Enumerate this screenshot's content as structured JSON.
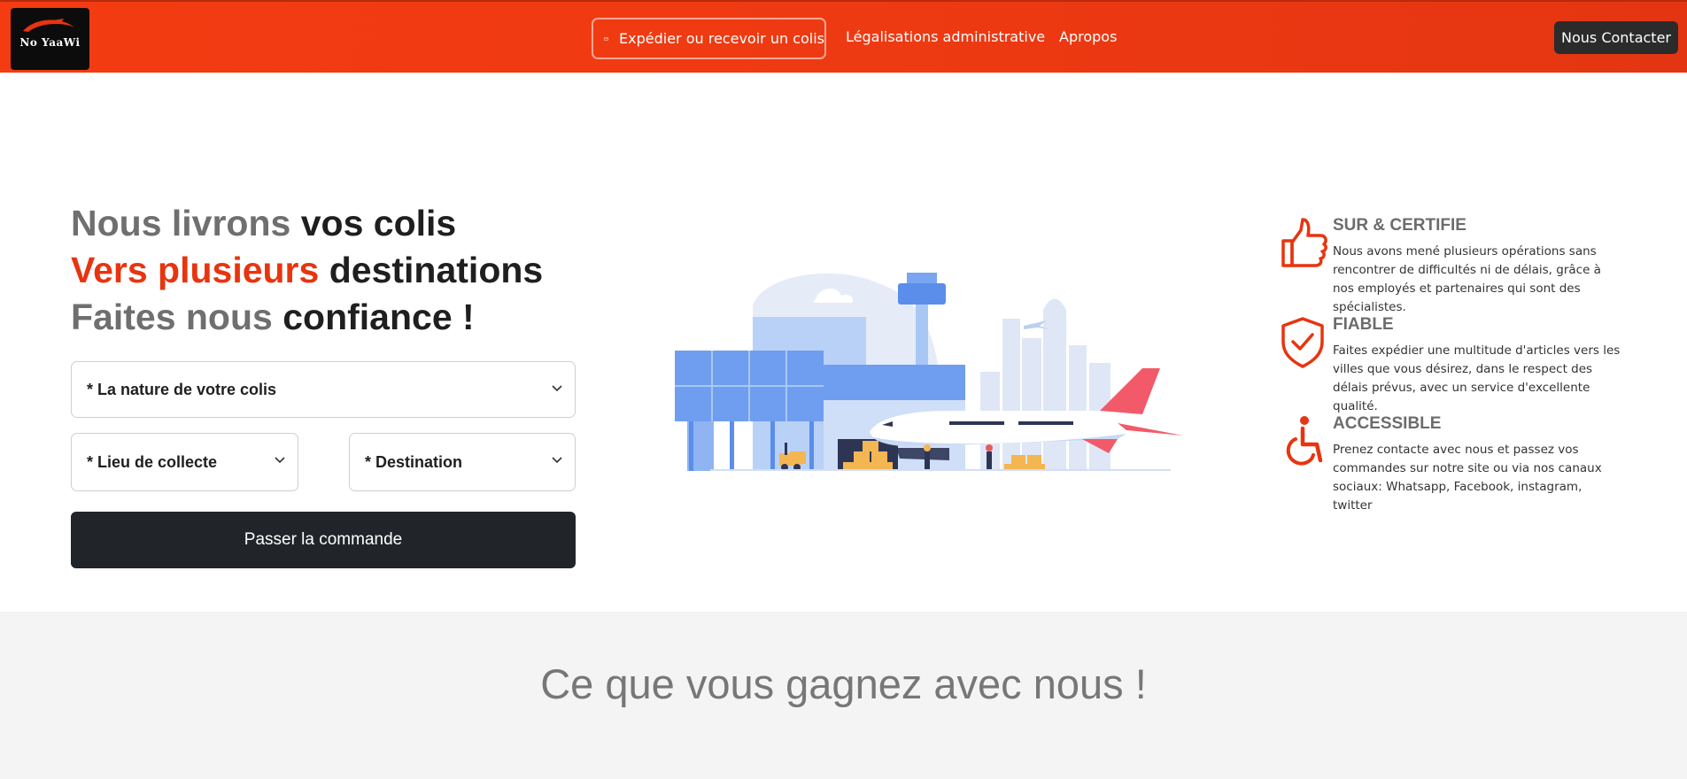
{
  "navbar": {
    "logo_text": "No YaaWi",
    "links": [
      {
        "label": "Expédier ou recevoir un colis",
        "icon": "mail-icon",
        "active": true
      },
      {
        "label": "Légalisations administrative"
      },
      {
        "label": "Apropos"
      }
    ],
    "contact_label": "Nous Contacter"
  },
  "hero": {
    "line1": {
      "a": "Nous livrons",
      "b": "vos colis"
    },
    "line2": {
      "a": "Vers plusieurs",
      "b": "destinations"
    },
    "line3": {
      "a": "Faites nous",
      "b": "confiance !"
    },
    "colors": {
      "accent": "#e8340f",
      "grey": "#6f6f6f",
      "dark": "#1f1f1f"
    }
  },
  "form": {
    "nature_label": "* La nature de votre colis",
    "lieu_label": "* Lieu de collecte",
    "destination_label": "* Destination",
    "submit_label": "Passer la commande"
  },
  "features": [
    {
      "icon": "thumbs-up-icon",
      "title": "SUR & CERTIFIE",
      "description": "Nous avons mené plusieurs opérations sans rencontrer de difficultés ni de délais, grâce à nos employés et partenaires qui sont des spécialistes."
    },
    {
      "icon": "shield-check-icon",
      "title": "FIABLE",
      "description": "Faites expédier une multitude d'articles vers les villes que vous désirez, dans le respect des délais prévus, avec un service d'excellente qualité."
    },
    {
      "icon": "wheelchair-icon",
      "title": "ACCESSIBLE",
      "description": "Prenez contacte avec nous et passez vos commandes sur notre site ou via nos canaux sociaux: Whatsapp, Facebook, instagram, twitter"
    }
  ],
  "section2": {
    "title": "Ce que vous gagnez avec nous !"
  }
}
